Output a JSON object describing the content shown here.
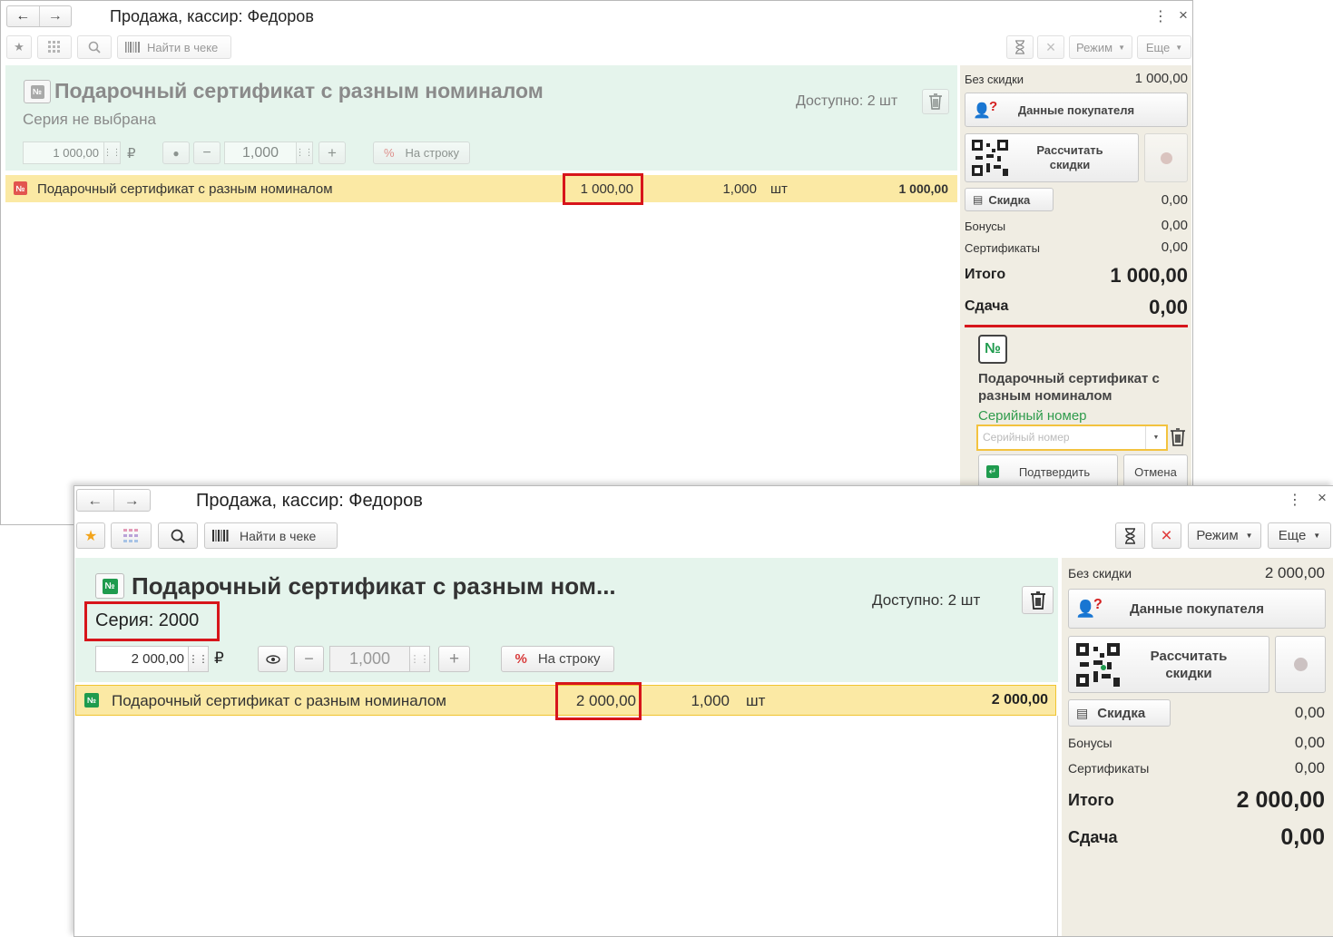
{
  "back_window": {
    "title": "Продажа, кассир: Федоров",
    "toolbar": {
      "find_label": "Найти в чеке",
      "mode_label": "Режим",
      "more_label": "Еще"
    },
    "product": {
      "name": "Подарочный сертификат с разным номиналом",
      "series": "Серия не выбрана",
      "available": "Доступно: 2 шт",
      "price": "1 000,00",
      "currency": "₽",
      "quantity": "1,000",
      "per_line_label": "На строку"
    },
    "row": {
      "name": "Подарочный сертификат с разным номиналом",
      "price": "1 000,00",
      "qty": "1,000",
      "unit": "шт",
      "sum": "1 000,00"
    },
    "summary": {
      "no_discount_label": "Без скидки",
      "no_discount_value": "1 000,00",
      "buyer_data_label": "Данные покупателя",
      "calc_discount_label": "Рассчитать скидки",
      "discount_label": "Скидка",
      "discount_value": "0,00",
      "bonuses_label": "Бонусы",
      "bonuses_value": "0,00",
      "certs_label": "Сертификаты",
      "certs_value": "0,00",
      "total_label": "Итого",
      "total_value": "1 000,00",
      "change_label": "Сдача",
      "change_value": "0,00"
    },
    "serial_panel": {
      "icon_text": "№",
      "name": "Подарочный сертификат с разным номиналом",
      "serial_label": "Серийный номер",
      "serial_placeholder": "Серийный номер",
      "confirm_label": "Подтвердить",
      "cancel_label": "Отмена"
    }
  },
  "front_window": {
    "title": "Продажа, кассир: Федоров",
    "toolbar": {
      "find_label": "Найти в чеке",
      "mode_label": "Режим",
      "more_label": "Еще"
    },
    "product": {
      "name": "Подарочный сертификат с разным ном...",
      "series": "Серия: 2000",
      "available": "Доступно: 2 шт",
      "price": "2 000,00",
      "currency": "₽",
      "quantity": "1,000",
      "per_line_label": "На строку"
    },
    "row": {
      "name": "Подарочный сертификат с разным номиналом",
      "price": "2 000,00",
      "qty": "1,000",
      "unit": "шт",
      "sum": "2 000,00"
    },
    "summary": {
      "no_discount_label": "Без скидки",
      "no_discount_value": "2 000,00",
      "buyer_data_label": "Данные покупателя",
      "calc_discount_label": "Рассчитать скидки",
      "discount_label": "Скидка",
      "discount_value": "0,00",
      "bonuses_label": "Бонусы",
      "bonuses_value": "0,00",
      "certs_label": "Сертификаты",
      "certs_value": "0,00",
      "total_label": "Итого",
      "total_value": "2 000,00",
      "change_label": "Сдача",
      "change_value": "0,00"
    }
  },
  "icons": {
    "number_badge": "№",
    "back_arrow": "←",
    "forward_arrow": "→",
    "star": "★",
    "menu_dots": "⋮",
    "close": "×",
    "plus": "+",
    "minus": "−",
    "percent": "%",
    "question": "?"
  },
  "colors": {
    "highlight_row": "#fbe9a4",
    "product_panel": "#e5f4ec",
    "summary_panel": "#f0ede3",
    "accent_red": "#d7151b",
    "cert_green": "#1f9b4e"
  }
}
